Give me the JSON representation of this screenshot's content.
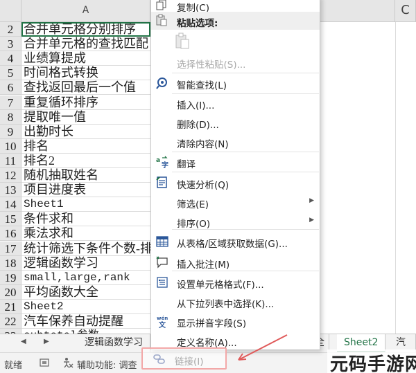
{
  "sheet": {
    "column_a": "A",
    "column_c": "C",
    "rows": [
      {
        "num": "2",
        "text": "合并单元格分别排序"
      },
      {
        "num": "3",
        "text": "合并单元格的查找匹配"
      },
      {
        "num": "4",
        "text": "业绩算提成"
      },
      {
        "num": "5",
        "text": "时间格式转换"
      },
      {
        "num": "6",
        "text": "查找返回最后一个值"
      },
      {
        "num": "7",
        "text": "重复循环排序"
      },
      {
        "num": "8",
        "text": "提取唯一值"
      },
      {
        "num": "9",
        "text": "出勤时长"
      },
      {
        "num": "10",
        "text": "排名"
      },
      {
        "num": "11",
        "text": "排名2"
      },
      {
        "num": "12",
        "text": "随机抽取姓名"
      },
      {
        "num": "13",
        "text": "项目进度表"
      },
      {
        "num": "14",
        "text": "Sheet1"
      },
      {
        "num": "15",
        "text": "条件求和"
      },
      {
        "num": "16",
        "text": "乘法求和"
      },
      {
        "num": "17",
        "text": "统计筛选下条件个数-排"
      },
      {
        "num": "18",
        "text": "逻辑函数学习"
      },
      {
        "num": "19",
        "text": "small,large,rank"
      },
      {
        "num": "20",
        "text": "平均函数大全"
      },
      {
        "num": "21",
        "text": "Sheet2"
      },
      {
        "num": "22",
        "text": "汽车保养自动提醒"
      },
      {
        "num": "23",
        "text": "subtotal参数"
      }
    ]
  },
  "tabs": {
    "nav_prev": "◀",
    "nav_next": "▶",
    "items": [
      {
        "label": "逻辑函数学习",
        "active": false
      },
      {
        "label": "全",
        "active": false
      },
      {
        "label": "Sheet2",
        "active": true
      },
      {
        "label": "汽车",
        "active": false
      }
    ]
  },
  "status": {
    "ready": "就绪",
    "accessibility": "辅助功能: 调查"
  },
  "menu": {
    "copy": "复制(C)",
    "paste_options": "粘贴选项:",
    "paste_special": "选择性粘贴(S)...",
    "smart_lookup": "智能查找(L)",
    "insert": "插入(I)...",
    "delete": "删除(D)...",
    "clear": "清除内容(N)",
    "translate": "翻译",
    "quick_analysis": "快速分析(Q)",
    "filter": "筛选(E)",
    "sort": "排序(O)",
    "get_data": "从表格/区域获取数据(G)...",
    "insert_comment": "插入批注(M)",
    "format_cells": "设置单元格格式(F)...",
    "pick_list": "从下拉列表中选择(K)...",
    "phonetic": "显示拼音字段(S)",
    "define_name": "定义名称(A)...",
    "link": "链接(I)"
  },
  "watermark": "元码手游网",
  "colors": {
    "excel_green": "#217346",
    "highlight_border": "#f3a8a8",
    "arrow_red": "#e05a5a",
    "icon_blue": "#2b579a"
  }
}
